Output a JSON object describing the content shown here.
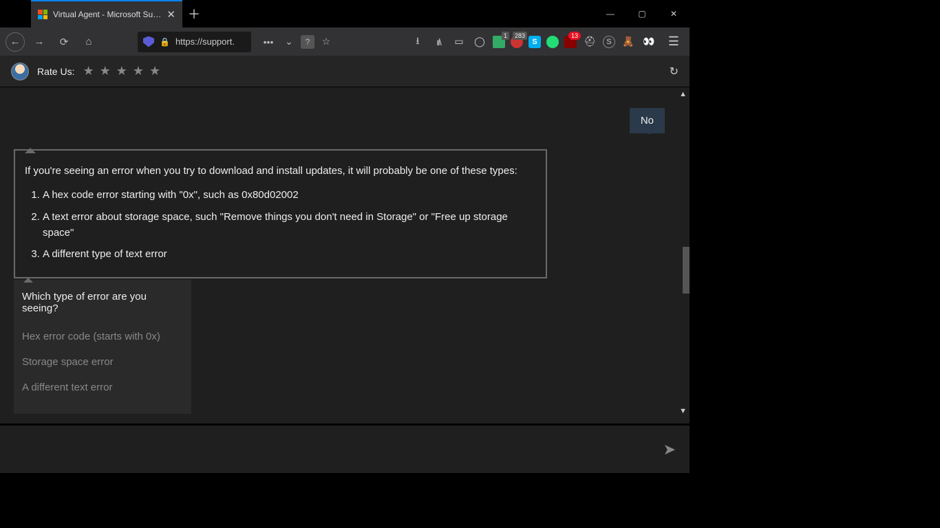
{
  "tab": {
    "title": "Virtual Agent - Microsoft Supp"
  },
  "url": "https://support.",
  "badges": {
    "ext1": "1",
    "ext2": "283",
    "ublock": "13"
  },
  "rate": {
    "label": "Rate Us:"
  },
  "chat": {
    "user_reply": "No",
    "agent_intro": "If you're seeing an error when you try to download and install updates, it will probably be one of these types:",
    "agent_items": [
      "A hex code error starting with \"0x\", such as 0x80d02002",
      "A text error about storage space, such \"Remove things you don't need in Storage\" or \"Free up storage space\"",
      "A different type of text error"
    ],
    "choice_question": "Which type of error are you seeing?",
    "choices": [
      "Hex error code (starts with 0x)",
      "Storage space error",
      "A different text error"
    ]
  }
}
